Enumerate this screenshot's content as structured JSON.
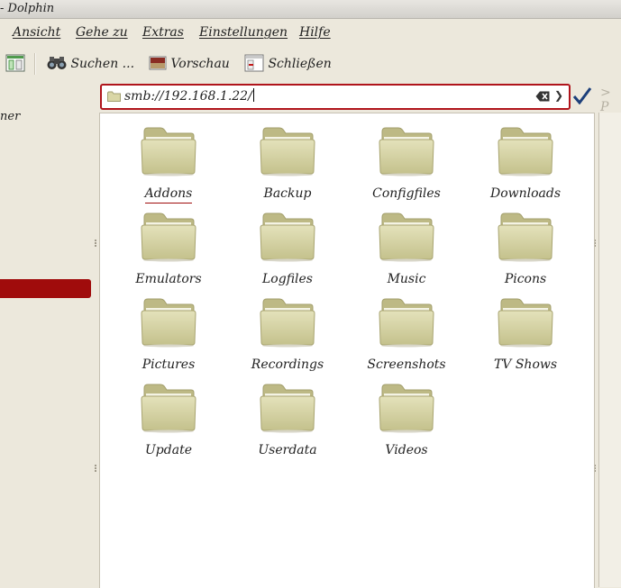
{
  "window": {
    "title": "- Dolphin"
  },
  "menubar": {
    "items": [
      {
        "label": "Ansicht"
      },
      {
        "label": "Gehe zu"
      },
      {
        "label": "Extras"
      },
      {
        "label": "Einstellungen"
      },
      {
        "label": "Hilfe"
      }
    ]
  },
  "toolbar": {
    "search_label": "Suchen ...",
    "preview_label": "Vorschau",
    "close_label": "Schließen"
  },
  "sidebar": {
    "partial_text": "ner"
  },
  "location": {
    "url": "smb://192.168.1.22/",
    "right_hint": "> P"
  },
  "files": [
    {
      "name": "Addons"
    },
    {
      "name": "Backup"
    },
    {
      "name": "Configfiles"
    },
    {
      "name": "Downloads"
    },
    {
      "name": "Emulators"
    },
    {
      "name": "Logfiles"
    },
    {
      "name": "Music"
    },
    {
      "name": "Picons"
    },
    {
      "name": "Pictures"
    },
    {
      "name": "Recordings"
    },
    {
      "name": "Screenshots"
    },
    {
      "name": "TV Shows"
    },
    {
      "name": "Update"
    },
    {
      "name": "Userdata"
    },
    {
      "name": "Videos"
    }
  ],
  "colors": {
    "accent": "#b0141b",
    "selection": "#a00c0c",
    "folder": "#d6d4a4",
    "window_bg": "#ece8dc"
  }
}
